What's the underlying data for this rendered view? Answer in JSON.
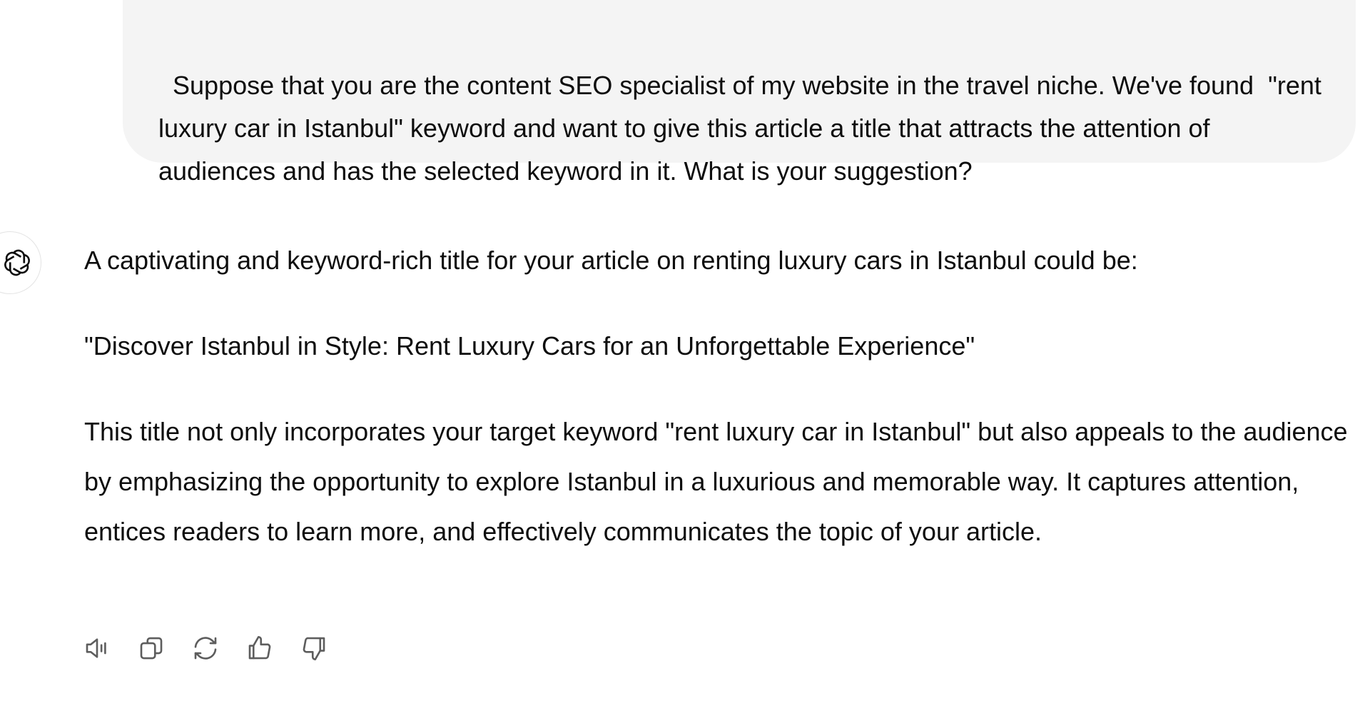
{
  "user_message": {
    "text": "Suppose that you are the content SEO specialist of my website in the travel niche. We've found  \"rent luxury car in Istanbul\" keyword and want to give this article a title that attracts the attention of audiences and has the selected keyword in it. What is your suggestion?"
  },
  "assistant_message": {
    "intro": "A captivating and keyword-rich title for your article on renting luxury cars in Istanbul could be:",
    "suggested_title": "\"Discover Istanbul in Style: Rent Luxury Cars for an Unforgettable Experience\"",
    "explanation": "This title not only incorporates your target keyword \"rent luxury car in Istanbul\" but also appeals to the audience by emphasizing the opportunity to explore Istanbul in a luxurious and memorable way. It captures attention, entices readers to learn more, and effectively communicates the topic of your article."
  },
  "actions": [
    {
      "icon": "speaker-icon"
    },
    {
      "icon": "copy-icon"
    },
    {
      "icon": "regenerate-icon"
    },
    {
      "icon": "thumbs-up-icon"
    },
    {
      "icon": "thumbs-down-icon"
    }
  ],
  "colors": {
    "user_bubble_bg": "#f4f4f4",
    "text": "#0d0d0d",
    "icon": "#5d5d5d"
  }
}
